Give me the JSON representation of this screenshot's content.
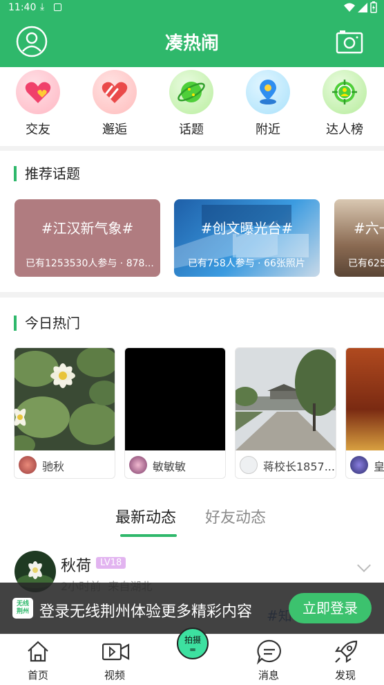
{
  "status": {
    "time": "11:40"
  },
  "app": {
    "title": "凑热闹"
  },
  "quick": [
    {
      "label": "交友",
      "icon": "heart-icon"
    },
    {
      "label": "邂逅",
      "icon": "hug-heart-icon"
    },
    {
      "label": "话题",
      "icon": "planet-icon"
    },
    {
      "label": "附近",
      "icon": "location-icon"
    },
    {
      "label": "达人榜",
      "icon": "target-person-icon"
    }
  ],
  "topics": {
    "title": "推荐话题",
    "cards": [
      {
        "tag": "#江汉新气象#",
        "info": "已有1253530人参与 · 878...",
        "color": "#b07c80"
      },
      {
        "tag": "#创文曝光台#",
        "info": "已有758人参与 · 66张照片",
        "color": "#2e7fc0"
      },
      {
        "tag": "#六一",
        "info": "已有625",
        "color": "#8a6a52"
      }
    ]
  },
  "hot": {
    "title": "今日热门",
    "cards": [
      {
        "name": "驰秋"
      },
      {
        "name": "敏敏敏"
      },
      {
        "name": "蒋校长1857..."
      },
      {
        "name": "皇"
      }
    ]
  },
  "tabs": {
    "latest": "最新动态",
    "friends": "好友动态"
  },
  "post": {
    "user": "秋荷",
    "level": "LV18",
    "meta": "2小时前  来自湖北",
    "preview": "#知"
  },
  "banner": {
    "logo_line1": "无线",
    "logo_line2": "荆州",
    "text": "登录无线荆州体验更多精彩内容",
    "button": "立即登录"
  },
  "nav": {
    "home": "首页",
    "video": "视频",
    "shoot": "拍摄",
    "messages": "消息",
    "discover": "发现"
  },
  "colors": {
    "brand": "#2fb86b"
  }
}
